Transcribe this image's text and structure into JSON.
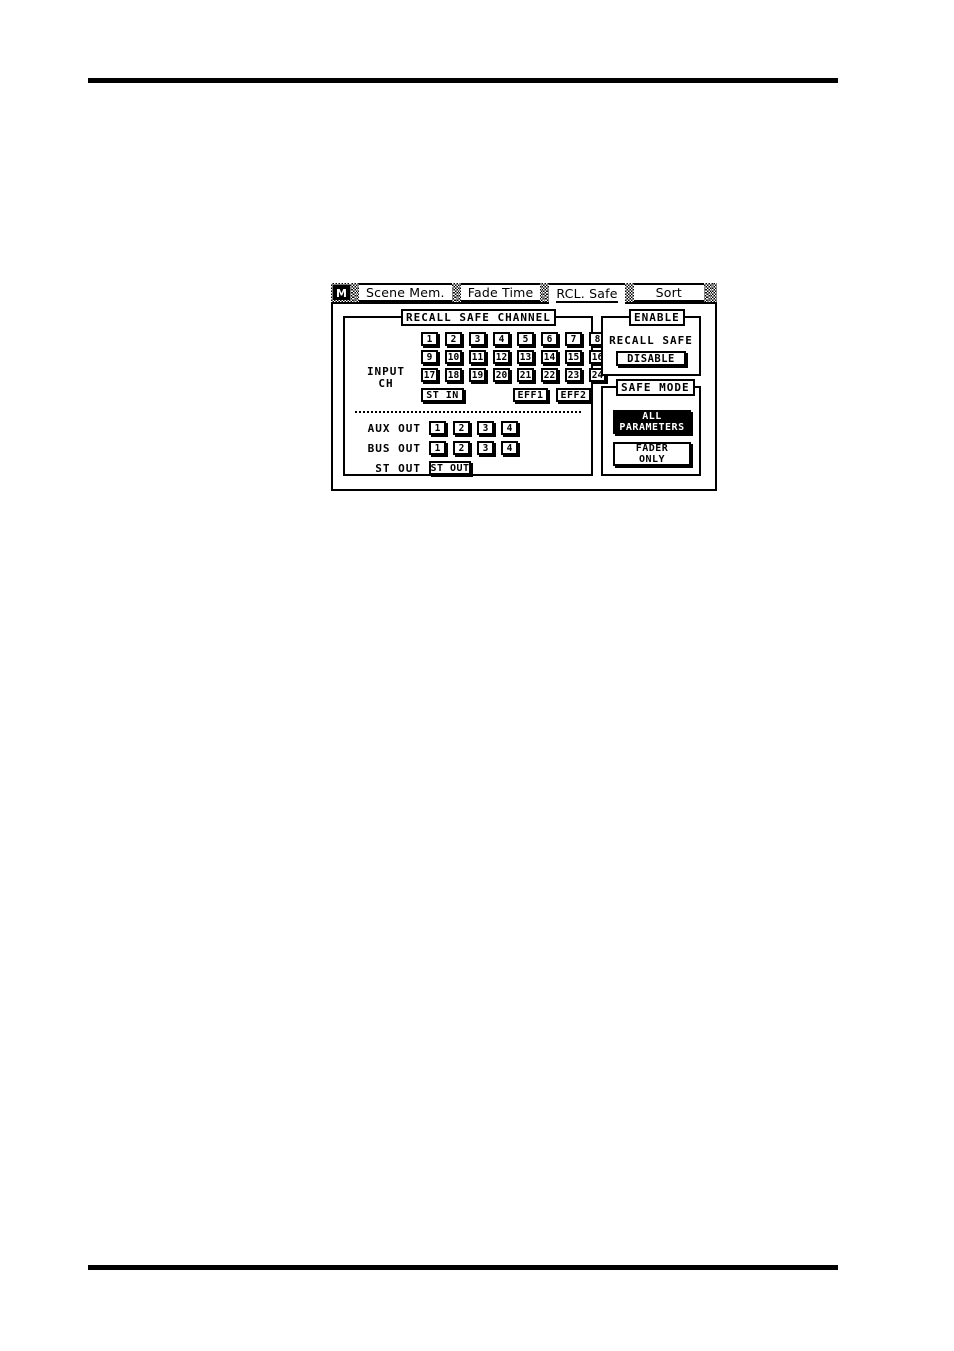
{
  "document": {
    "rules": [
      "top-rule",
      "bottom-rule"
    ]
  },
  "lcd": {
    "tabs": {
      "menu_badge": "M",
      "items": [
        {
          "label": "Scene Mem.",
          "active": false
        },
        {
          "label": "Fade Time",
          "active": false
        },
        {
          "label": "RCL. Safe",
          "active": true
        },
        {
          "label": "Sort",
          "active": false
        }
      ]
    },
    "recall_safe_channel": {
      "title": "RECALL SAFE CHANNEL",
      "input_ch_label_line1": "INPUT",
      "input_ch_label_line2": "CH",
      "channel_rows": [
        [
          "1",
          "2",
          "3",
          "4",
          "5",
          "6",
          "7",
          "8"
        ],
        [
          "9",
          "10",
          "11",
          "12",
          "13",
          "14",
          "15",
          "16"
        ],
        [
          "17",
          "18",
          "19",
          "20",
          "21",
          "22",
          "23",
          "24"
        ]
      ],
      "st_in": "ST IN",
      "eff1": "EFF1",
      "eff2": "EFF2",
      "aux_out_label": "AUX OUT",
      "aux_out_buttons": [
        "1",
        "2",
        "3",
        "4"
      ],
      "bus_out_label": "BUS OUT",
      "bus_out_buttons": [
        "1",
        "2",
        "3",
        "4"
      ],
      "st_out_label": "ST OUT",
      "st_out_button": "ST OUT"
    },
    "enable": {
      "title": "ENABLE",
      "caption": "RECALL SAFE",
      "state_button": "DISABLE"
    },
    "safe_mode": {
      "title": "SAFE MODE",
      "all_parameters_line1": "ALL",
      "all_parameters_line2": "PARAMETERS",
      "all_parameters_selected": true,
      "fader_only_line1": "FADER",
      "fader_only_line2": "ONLY",
      "fader_only_selected": false
    }
  },
  "colors": {
    "ink": "#000000",
    "paper": "#ffffff"
  }
}
